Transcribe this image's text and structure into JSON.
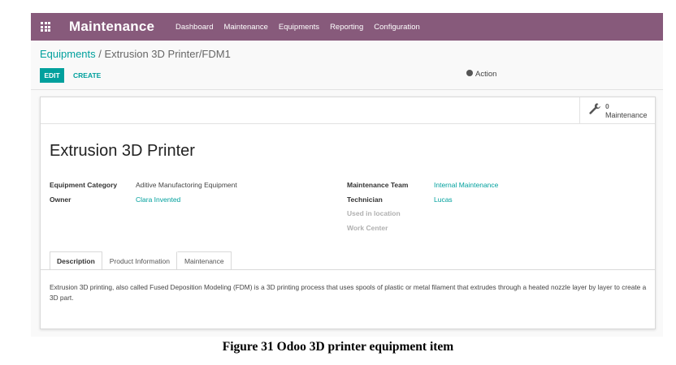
{
  "topbar": {
    "app_title": "Maintenance",
    "apps_icon": "grid-apps-icon",
    "menu": [
      "Dashboard",
      "Maintenance",
      "Equipments",
      "Reporting",
      "Configuration"
    ]
  },
  "breadcrumb": {
    "parent": "Equipments",
    "separator": " / ",
    "current": "Extrusion 3D Printer/FDM1"
  },
  "buttons": {
    "edit": "EDIT",
    "create": "CREATE",
    "action": "Action"
  },
  "stat_button": {
    "count": "0",
    "label": "Maintenance",
    "icon": "wrench-icon"
  },
  "record": {
    "name": "Extrusion 3D Printer",
    "left_fields": [
      {
        "label": "Equipment Category",
        "value": "Aditive Manufactoring Equipment"
      },
      {
        "label": "Owner",
        "value": "Clara Invented"
      }
    ],
    "right_fields": [
      {
        "label": "Maintenance Team",
        "value": "Internal Maintenance"
      },
      {
        "label": "Technician",
        "value": "Lucas"
      },
      {
        "label": "Used in location",
        "value": ""
      },
      {
        "label": "Work Center",
        "value": ""
      }
    ]
  },
  "tabs": [
    "Description",
    "Product Information",
    "Maintenance"
  ],
  "description": "Extrusion 3D printing, also called Fused Deposition Modeling (FDM) is a 3D printing process that uses spools of plastic or metal filament that extrudes through a heated nozzle layer by layer to create a 3D part.",
  "caption": "Figure 31 Odoo 3D printer equipment item",
  "colors": {
    "brand": "#875a7b",
    "accent": "#00a09d"
  }
}
